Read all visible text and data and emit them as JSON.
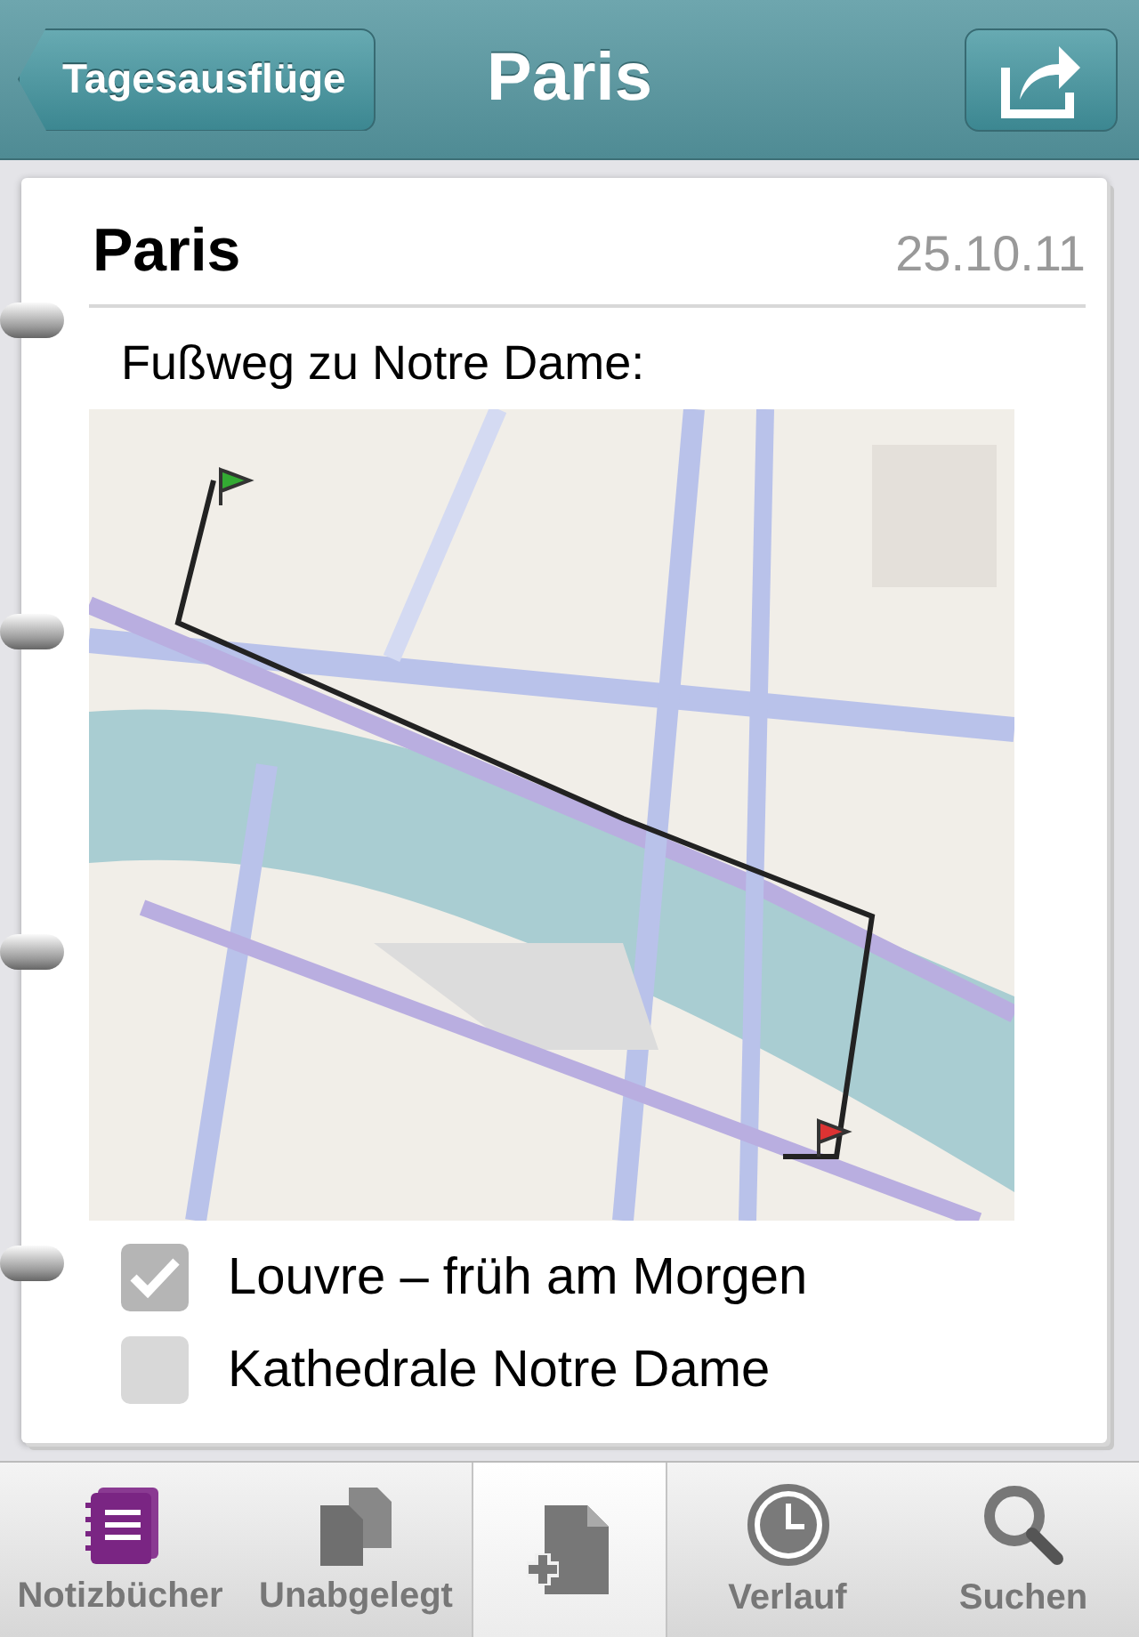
{
  "header": {
    "back": "Tagesausflüge",
    "title": "Paris"
  },
  "note": {
    "title": "Paris",
    "date": "25.10.11",
    "text": "Fußweg zu Notre Dame:",
    "checklist": [
      {
        "label": "Louvre – früh am Morgen",
        "checked": true
      },
      {
        "label": "Kathedrale Notre Dame",
        "checked": false
      }
    ]
  },
  "tabs": [
    {
      "kind": "notebooks",
      "label": "Notizbücher"
    },
    {
      "kind": "unfiled",
      "label": "Unabgelegt"
    },
    {
      "kind": "new"
    },
    {
      "kind": "history",
      "label": "Verlauf"
    },
    {
      "kind": "search",
      "label": "Suchen"
    }
  ]
}
